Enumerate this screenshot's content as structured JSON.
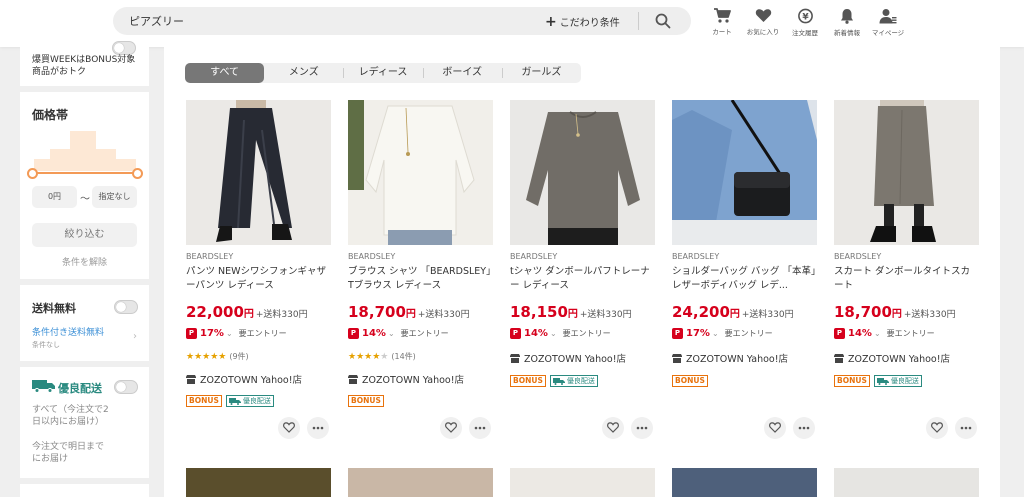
{
  "header": {
    "search_value": "ピアズリー",
    "kodawari_label": "こだわり条件",
    "icons": [
      {
        "name": "cart-icon",
        "label": "カート"
      },
      {
        "name": "heart-icon",
        "label": "お気に入り"
      },
      {
        "name": "order-history-icon",
        "label": "注文履歴"
      },
      {
        "name": "bell-icon",
        "label": "新着情報"
      },
      {
        "name": "mypage-icon",
        "label": "マイページ"
      }
    ]
  },
  "sidebar": {
    "promo_line1": "爆買WEEKはBONUS対象",
    "promo_line2": "商品がおトク",
    "price_heading": "価格帯",
    "price_min": "0円",
    "price_tilde": "〜",
    "price_max": "指定なし",
    "narrow_button": "絞り込む",
    "clear_link": "条件を解除",
    "free_shipping": "送料無料",
    "conditional_shipping": "条件付き送料無料",
    "conditional_sub": "条件なし",
    "priority_delivery": "優良配送",
    "delivery_option1_l1": "すべて（今注文で2",
    "delivery_option1_l2": "日以内にお届け）",
    "delivery_option2_l1": "今注文で明日まで",
    "delivery_option2_l2": "にお届け"
  },
  "tabs": [
    "すべて",
    "メンズ",
    "レディース",
    "ボーイズ",
    "ガールズ"
  ],
  "products": [
    {
      "brand": "BEARDSLEY",
      "title": "パンツ NEWシワシフォンギャザーパンツ レディース",
      "price": "22,000",
      "yen": "円",
      "shipping": "+送料330円",
      "discount": "17%",
      "entry": "要エントリー",
      "stars": "★★★★★",
      "rating": 4.5,
      "review_count": "(9件)",
      "store": "ZOZOTOWN Yahoo!店",
      "bonus": "BONUS",
      "yuryo": "優良配送"
    },
    {
      "brand": "BEARDSLEY",
      "title": "ブラウス シャツ 「BEARDSLEY」Tブラウス レディース",
      "price": "18,700",
      "yen": "円",
      "shipping": "+送料330円",
      "discount": "14%",
      "entry": "要エントリー",
      "stars": "★★★★",
      "stars_off": "★",
      "rating": 4,
      "review_count": "(14件)",
      "store": "ZOZOTOWN Yahoo!店",
      "bonus": "BONUS"
    },
    {
      "brand": "BEARDSLEY",
      "title": "tシャツ ダンボールパフトレーナー レディース",
      "price": "18,150",
      "yen": "円",
      "shipping": "+送料330円",
      "discount": "14%",
      "entry": "要エントリー",
      "store": "ZOZOTOWN Yahoo!店",
      "bonus": "BONUS",
      "yuryo": "優良配送"
    },
    {
      "brand": "BEARDSLEY",
      "title": "ショルダーバッグ バッグ 「本革」レザーボディバッグ レデ...",
      "price": "24,200",
      "yen": "円",
      "shipping": "+送料330円",
      "discount": "17%",
      "entry": "要エントリー",
      "store": "ZOZOTOWN Yahoo!店",
      "bonus": "BONUS"
    },
    {
      "brand": "BEARDSLEY",
      "title": "スカート ダンボールタイトスカート",
      "price": "18,700",
      "yen": "円",
      "shipping": "+送料330円",
      "discount": "14%",
      "entry": "要エントリー",
      "store": "ZOZOTOWN Yahoo!店",
      "bonus": "BONUS",
      "yuryo": "優良配送"
    }
  ],
  "colors": {
    "price_red": "#d6001c",
    "bonus_orange": "#e8720c",
    "yuryo_teal": "#2a8a80",
    "slider_orange": "#f39a56"
  }
}
